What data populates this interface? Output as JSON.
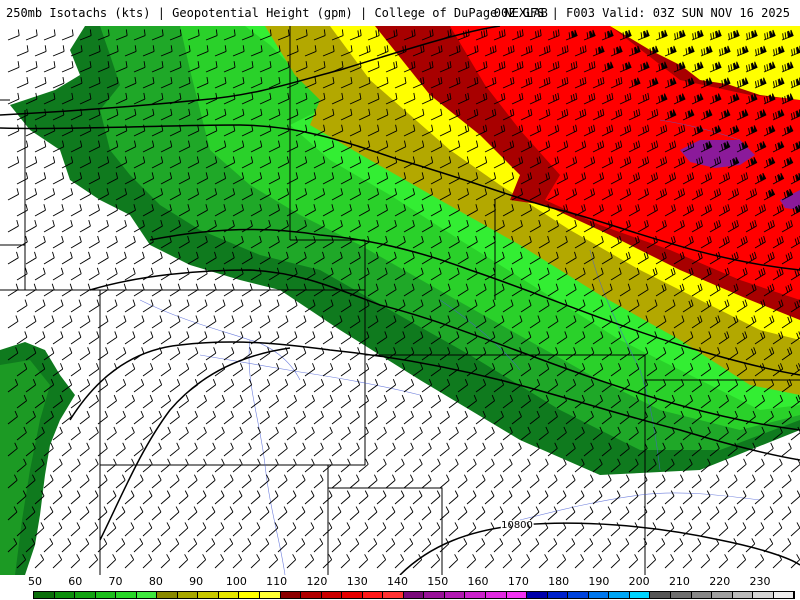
{
  "header": {
    "title_left": "250mb Isotachs (kts) | Geopotential Height (gpm) | College of DuPage NEXLAB",
    "title_right": "00Z GFS | F003 Valid: 03Z SUN NOV 16 2025"
  },
  "map": {
    "contour_label": "10800"
  },
  "colorbar": {
    "tick_labels": [
      "50",
      "60",
      "70",
      "80",
      "90",
      "100",
      "110",
      "120",
      "130",
      "140",
      "150",
      "160",
      "170",
      "180",
      "190",
      "200",
      "210",
      "220",
      "230"
    ],
    "swatches": [
      "#0a6e0a",
      "#0d8f0d",
      "#13a313",
      "#1cbf1c",
      "#28d628",
      "#3fe83f",
      "#8a8a00",
      "#a8a800",
      "#c8c800",
      "#e6e600",
      "#ffff00",
      "#ffff33",
      "#8b0000",
      "#b00000",
      "#cc0000",
      "#e60000",
      "#ff1a1a",
      "#ff3333",
      "#7a0a7a",
      "#991299",
      "#b31ab3",
      "#cc22cc",
      "#e02ae0",
      "#f233f2",
      "#0000aa",
      "#0022cc",
      "#0044dd",
      "#0077ee",
      "#00a6f5",
      "#00d5ff",
      "#555555",
      "#6e6e6e",
      "#888888",
      "#a0a0a0",
      "#bbbbbb",
      "#d5d5d5",
      "#eeeeee"
    ]
  },
  "legend_colors": {
    "green_dark": "#0f7a1e",
    "green": "#1fb51f",
    "green_bright": "#33ee33",
    "olive": "#b3a800",
    "yellow": "#ffff00",
    "dark_red": "#a80000",
    "red": "#ff0000",
    "purple": "#8b1a9a"
  }
}
